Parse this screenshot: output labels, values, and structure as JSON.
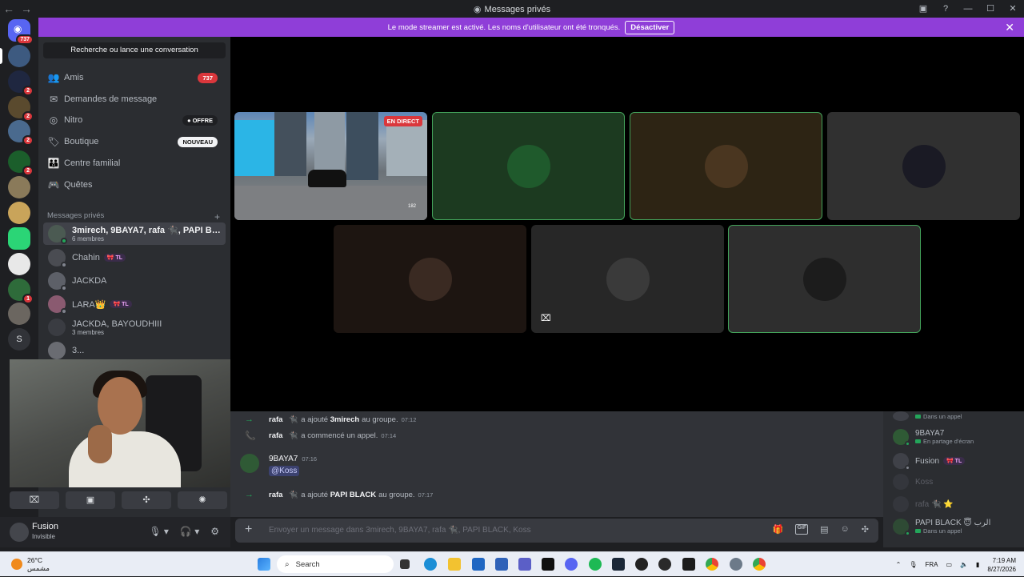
{
  "window": {
    "title": "Messages privés",
    "back": "←",
    "forward": "→",
    "controls": [
      "▣",
      "?",
      "—",
      "☐",
      "✕"
    ]
  },
  "banner": {
    "text": "Le mode streamer est activé. Les noms d'utilisateur ont été tronqués.",
    "button": "Désactiver",
    "close": "✕"
  },
  "servers": {
    "home_badge": "737",
    "badges": [
      "2",
      "2",
      "2",
      "2",
      "1"
    ],
    "letter_server": "S"
  },
  "sidebar": {
    "search": "Recherche ou lance une conversation",
    "nav": [
      {
        "label": "Amis",
        "icon": "friends-icon",
        "glyph": "👥",
        "tag": "737"
      },
      {
        "label": "Demandes de message",
        "icon": "mail-icon",
        "glyph": "✉",
        "tag": ""
      },
      {
        "label": "Nitro",
        "icon": "nitro-icon",
        "glyph": "◎",
        "tag": "● OFFRE"
      },
      {
        "label": "Boutique",
        "icon": "shop-icon",
        "glyph": "🏷",
        "tag": "NOUVEAU"
      },
      {
        "label": "Centre familial",
        "icon": "family-icon",
        "glyph": "👪",
        "tag": ""
      },
      {
        "label": "Quêtes",
        "icon": "quests-icon",
        "glyph": "🎮",
        "tag": ""
      }
    ],
    "dm_header": "Messages privés",
    "dm_add": "+",
    "dms": [
      {
        "name": "3mirech, 9BAYA7, rafa 🐈‍⬛, PAPI BLACK,...",
        "sub": "6 membres",
        "tag": ""
      },
      {
        "name": "Chahin",
        "sub": "",
        "tag": "🎀 TL"
      },
      {
        "name": "JACKDA",
        "sub": "",
        "tag": ""
      },
      {
        "name": "LARA👑",
        "sub": "",
        "tag": "🎀 TL"
      },
      {
        "name": "JACKDA, BAYOUDHIII",
        "sub": "3 membres",
        "tag": ""
      },
      {
        "name": "3...",
        "sub": "",
        "tag": ""
      }
    ]
  },
  "voice_controls": [
    "⌧",
    "▣",
    "✣",
    "✺"
  ],
  "user": {
    "name": "Fusion",
    "status": "Invisible",
    "icons": [
      "🎙 ▾",
      "🎧 ▾",
      "⚙"
    ]
  },
  "stage": {
    "live_label": "EN DIRECT",
    "stream_hud": "182",
    "muted_icon": "⌧"
  },
  "chat": {
    "system": [
      {
        "icon": "→",
        "actor": "rafa",
        "emoji": "🐈‍⬛",
        "action": "a ajouté",
        "target": "3mirech",
        "suffix": "au groupe.",
        "time": "07:12"
      },
      {
        "icon": "📞",
        "actor": "rafa",
        "emoji": "🐈‍⬛",
        "action": "a commencé un appel.",
        "target": "",
        "suffix": "",
        "time": "07:14"
      },
      {
        "icon": "→",
        "actor": "rafa",
        "emoji": "🐈‍⬛",
        "action": "a ajouté",
        "target": "PAPI BLACK",
        "suffix": "au groupe.",
        "time": "07:17"
      }
    ],
    "message": {
      "author": "9BAYA7",
      "time": "07:16",
      "text": "@Koss"
    },
    "composer_placeholder": "Envoyer un message dans 3mirech, 9BAYA7, rafa 🐈‍⬛, PAPI BLACK, Koss",
    "composer_tools": [
      "🎁",
      "GIF",
      "▤",
      "☺",
      "✣"
    ]
  },
  "members": [
    {
      "name": "",
      "activity": "Dans un appel"
    },
    {
      "name": "9BAYA7",
      "activity": "En partage d'écran"
    },
    {
      "name": "Fusion",
      "activity": "",
      "tag": "🎀 TL"
    },
    {
      "name": "Koss",
      "activity": ""
    },
    {
      "name": "rafa 🐈‍⬛ ⭐",
      "activity": ""
    },
    {
      "name": "PAPI BLACK 😇 الرب",
      "activity": "Dans un appel"
    }
  ],
  "taskbar": {
    "temp": "26°C",
    "weather": "مشمس",
    "search": "Search",
    "lang": "FRA",
    "time": "7:19 AM",
    "date": "8/27/2026",
    "tray_up": "⌃"
  },
  "colors": {
    "banner": "#8f3ed8",
    "speaking": "#43a25a",
    "badge": "#da373c"
  }
}
